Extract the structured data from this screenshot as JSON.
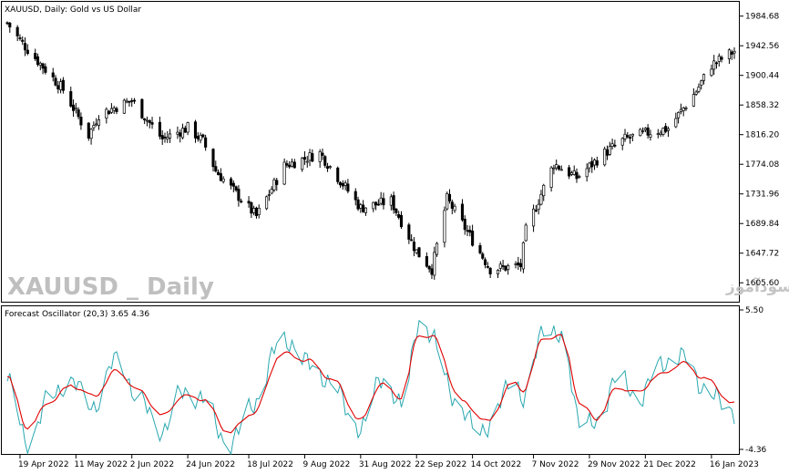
{
  "window": {
    "title": "XAUUSD, Daily:  Gold vs US Dollar",
    "watermark_symbol": "XAUUSD _ Daily",
    "watermark_site": "انتشار در سایت سودآموز"
  },
  "price_axis": {
    "labels": [
      "1984.68",
      "1942.56",
      "1900.44",
      "1858.32",
      "1816.20",
      "1774.08",
      "1731.96",
      "1689.84",
      "1647.72",
      "1605.60"
    ]
  },
  "time_axis": {
    "labels": [
      "19 Apr 2022",
      "11 May 2022",
      "2 Jun 2022",
      "24 Jun 2022",
      "18 Jul 2022",
      "9 Aug 2022",
      "31 Aug 2022",
      "22 Sep 2022",
      "14 Oct 2022",
      "7 Nov 2022",
      "29 Nov 2022",
      "21 Dec 2022",
      "16 Jan 2023"
    ]
  },
  "indicator": {
    "title": "Forecast Oscillator (20,3) 3.65 4.36",
    "axis_top": "5.50",
    "axis_bottom": "-4.36"
  },
  "colors": {
    "background": "#ffffff",
    "candles": "#000000",
    "oscillator": "#2aa8b0",
    "signal": "#e00000"
  },
  "chart_data": [
    {
      "type": "candlestick",
      "title": "XAUUSD, Daily:  Gold vs US Dollar",
      "ylim": [
        1580,
        2005
      ],
      "x_start": "2022-04-14",
      "x_end": "2023-01-25",
      "anchors": [
        {
          "date": "2022-04-14",
          "close": 1975
        },
        {
          "date": "2022-04-19",
          "close": 1950
        },
        {
          "date": "2022-05-06",
          "close": 1880
        },
        {
          "date": "2022-05-16",
          "close": 1815
        },
        {
          "date": "2022-05-20",
          "close": 1845
        },
        {
          "date": "2022-06-02",
          "close": 1865
        },
        {
          "date": "2022-06-14",
          "close": 1810
        },
        {
          "date": "2022-06-24",
          "close": 1826
        },
        {
          "date": "2022-06-30",
          "close": 1807
        },
        {
          "date": "2022-07-05",
          "close": 1765
        },
        {
          "date": "2022-07-21",
          "close": 1700
        },
        {
          "date": "2022-08-01",
          "close": 1772
        },
        {
          "date": "2022-08-15",
          "close": 1790
        },
        {
          "date": "2022-08-31",
          "close": 1712
        },
        {
          "date": "2022-09-12",
          "close": 1722
        },
        {
          "date": "2022-09-22",
          "close": 1650
        },
        {
          "date": "2022-09-28",
          "close": 1625
        },
        {
          "date": "2022-10-04",
          "close": 1725
        },
        {
          "date": "2022-10-21",
          "close": 1625
        },
        {
          "date": "2022-11-02",
          "close": 1630
        },
        {
          "date": "2022-11-04",
          "close": 1680
        },
        {
          "date": "2022-11-15",
          "close": 1775
        },
        {
          "date": "2022-11-24",
          "close": 1755
        },
        {
          "date": "2022-12-05",
          "close": 1790
        },
        {
          "date": "2022-12-13",
          "close": 1810
        },
        {
          "date": "2022-12-21",
          "close": 1818
        },
        {
          "date": "2022-12-30",
          "close": 1825
        },
        {
          "date": "2023-01-10",
          "close": 1878
        },
        {
          "date": "2023-01-16",
          "close": 1915
        },
        {
          "date": "2023-01-25",
          "close": 1935
        }
      ]
    },
    {
      "type": "line",
      "title": "Forecast Oscillator (20,3) 3.65 4.36",
      "ylim": [
        -4.36,
        5.5
      ],
      "series": [
        {
          "name": "",
          "color": "#2aa8b0",
          "points": [
            [
              "2022-04-14",
              0.5
            ],
            [
              "2022-04-22",
              -3.6
            ],
            [
              "2022-05-01",
              -0.5
            ],
            [
              "2022-05-09",
              0.5
            ],
            [
              "2022-05-18",
              -1.2
            ],
            [
              "2022-05-27",
              2.0
            ],
            [
              "2022-06-05",
              -0.8
            ],
            [
              "2022-06-14",
              -2.8
            ],
            [
              "2022-06-22",
              -0.2
            ],
            [
              "2022-06-30",
              -0.7
            ],
            [
              "2022-07-10",
              -3.8
            ],
            [
              "2022-07-20",
              -1.0
            ],
            [
              "2022-07-31",
              3.4
            ],
            [
              "2022-08-10",
              1.8
            ],
            [
              "2022-08-20",
              0.2
            ],
            [
              "2022-08-31",
              -2.8
            ],
            [
              "2022-09-08",
              0.8
            ],
            [
              "2022-09-16",
              -1.2
            ],
            [
              "2022-09-23",
              4.4
            ],
            [
              "2022-09-28",
              3.3
            ],
            [
              "2022-10-10",
              -1.8
            ],
            [
              "2022-10-20",
              -2.8
            ],
            [
              "2022-10-30",
              1.0
            ],
            [
              "2022-11-03",
              -1.0
            ],
            [
              "2022-11-11",
              4.2
            ],
            [
              "2022-11-18",
              3.2
            ],
            [
              "2022-11-26",
              -2.2
            ],
            [
              "2022-12-02",
              -2.5
            ],
            [
              "2022-12-10",
              1.0
            ],
            [
              "2022-12-18",
              -0.8
            ],
            [
              "2022-12-26",
              1.5
            ],
            [
              "2023-01-05",
              2.2
            ],
            [
              "2023-01-13",
              0.0
            ],
            [
              "2023-01-25",
              -1.6
            ]
          ]
        },
        {
          "name": "",
          "color": "#e00000",
          "points": [
            [
              "2022-04-14",
              0.8
            ],
            [
              "2022-04-22",
              -2.6
            ],
            [
              "2022-05-01",
              -0.8
            ],
            [
              "2022-05-09",
              0.2
            ],
            [
              "2022-05-18",
              -0.5
            ],
            [
              "2022-05-27",
              1.2
            ],
            [
              "2022-06-05",
              -0.2
            ],
            [
              "2022-06-14",
              -1.8
            ],
            [
              "2022-06-22",
              -0.5
            ],
            [
              "2022-06-30",
              -0.7
            ],
            [
              "2022-07-10",
              -2.9
            ],
            [
              "2022-07-20",
              -1.6
            ],
            [
              "2022-07-31",
              2.4
            ],
            [
              "2022-08-10",
              1.9
            ],
            [
              "2022-08-20",
              0.6
            ],
            [
              "2022-08-31",
              -2.1
            ],
            [
              "2022-09-08",
              0.3
            ],
            [
              "2022-09-16",
              -0.6
            ],
            [
              "2022-09-23",
              3.6
            ],
            [
              "2022-09-28",
              3.5
            ],
            [
              "2022-10-10",
              -0.9
            ],
            [
              "2022-10-20",
              -2.2
            ],
            [
              "2022-10-30",
              0.4
            ],
            [
              "2022-11-03",
              -0.1
            ],
            [
              "2022-11-11",
              3.4
            ],
            [
              "2022-11-18",
              3.5
            ],
            [
              "2022-11-26",
              -1.2
            ],
            [
              "2022-12-02",
              -2.0
            ],
            [
              "2022-12-10",
              0.1
            ],
            [
              "2022-12-18",
              -0.3
            ],
            [
              "2022-12-26",
              0.9
            ],
            [
              "2023-01-05",
              1.7
            ],
            [
              "2023-01-13",
              0.7
            ],
            [
              "2023-01-25",
              -1.0
            ]
          ]
        }
      ]
    }
  ]
}
